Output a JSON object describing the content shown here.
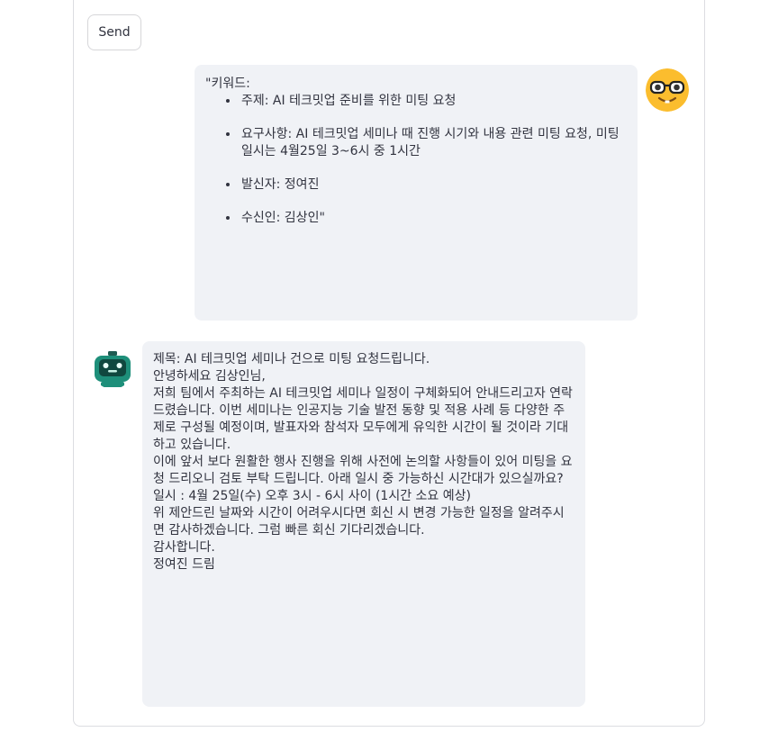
{
  "send_button": {
    "label": "Send"
  },
  "messages": {
    "user": {
      "avatar_icon": "nerd-face-icon",
      "intro": "\"키워드:",
      "items": [
        "주제: AI 테크밋업 준비를 위한 미팅 요청",
        "요구사항: AI 테크밋업 세미나 때 진행 시기와 내용 관련 미팅 요청, 미팅 일시는 4월25일 3~6시 중 1시간",
        "발신자: 정여진",
        "수신인: 김상인\""
      ]
    },
    "assistant": {
      "avatar_icon": "robot-icon",
      "blocks": [
        "제목: AI 테크밋업 세미나 건으로 미팅 요청드립니다.",
        "안녕하세요 김상인님,",
        "저희 팀에서 주최하는 AI 테크밋업 세미나 일정이 구체화되어 안내드리고자 연락드렸습니다. 이번 세미나는 인공지능 기술 발전 동향 및 적용 사례 등 다양한 주제로 구성될 예정이며, 발표자와 참석자 모두에게 유익한 시간이 될 것이라 기대하고 있습니다.",
        "이에 앞서 보다 원활한 행사 진행을 위해 사전에 논의할 사항들이 있어 미팅을 요청 드리오니 검토 부탁 드립니다. 아래 일시 중 가능하신 시간대가 있으실까요?",
        "일시 : 4월 25일(수) 오후 3시 - 6시 사이 (1시간 소요 예상)",
        "위 제안드린 날짜와 시간이 어려우시다면 회신 시 변경 가능한 일정을 알려주시면 감사하겠습니다. 그럼 빠른 회신 기다리겠습니다.",
        "감사합니다.\n정여진 드림"
      ]
    }
  },
  "colors": {
    "bubble_bg": "#f0f2f6",
    "text": "#31333f",
    "user_avatar": "#fbbd2e",
    "bot_avatar": "#1e8f7a"
  }
}
